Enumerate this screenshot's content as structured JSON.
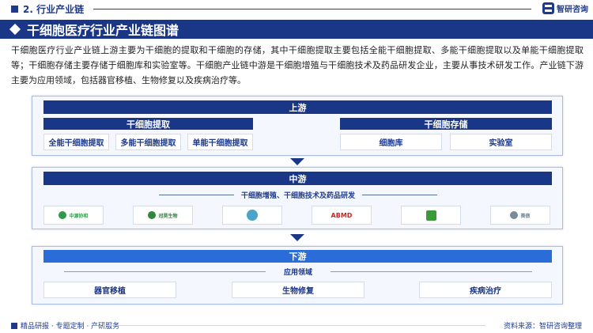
{
  "header": {
    "section": "2. 行业产业链",
    "logo_text": "智研咨询"
  },
  "title": "干细胞医疗行业产业链图谱",
  "intro": "干细胞医疗行业产业链上游主要为干细胞的提取和干细胞的存储，其中干细胞提取主要包括全能干细胞提取、多能干细胞提取以及单能干细胞提取等；干细胞存储主要存储于细胞库和实验室等。干细胞产业链中游是干细胞增殖与干细胞技术及药品研发企业，主要从事技术研发工作。产业链下游主要为应用领域，包括器官移植、生物修复以及疾病治疗等。",
  "upstream": {
    "label": "上游",
    "extraction": {
      "label": "干细胞提取",
      "items": [
        "全能干细胞提取",
        "多能干细胞提取",
        "单能干细胞提取"
      ]
    },
    "storage": {
      "label": "干细胞存储",
      "items": [
        "细胞库",
        "实验室"
      ]
    }
  },
  "midstream": {
    "label": "中游",
    "subtitle": "干细胞增殖、干细胞技术及药品研发",
    "logos": [
      {
        "name": "中源协和",
        "color": "#2e9a4a"
      },
      {
        "name": "冠昊生物",
        "color": "#2e8a3a"
      },
      {
        "name": "",
        "color": "#4aa3c8"
      },
      {
        "name": "ABMD",
        "color": "#c62828"
      },
      {
        "name": "",
        "color": "#3a9a3a"
      },
      {
        "name": "赛傲",
        "color": "#7a8a99"
      }
    ]
  },
  "downstream": {
    "label": "下游",
    "subtitle": "应用领域",
    "items": [
      "器官移植",
      "生物修复",
      "疾病治疗"
    ]
  },
  "footer": {
    "left": "精品研报 · 专题定制 · 产研服务",
    "right": "资料来源：智研咨询整理"
  }
}
